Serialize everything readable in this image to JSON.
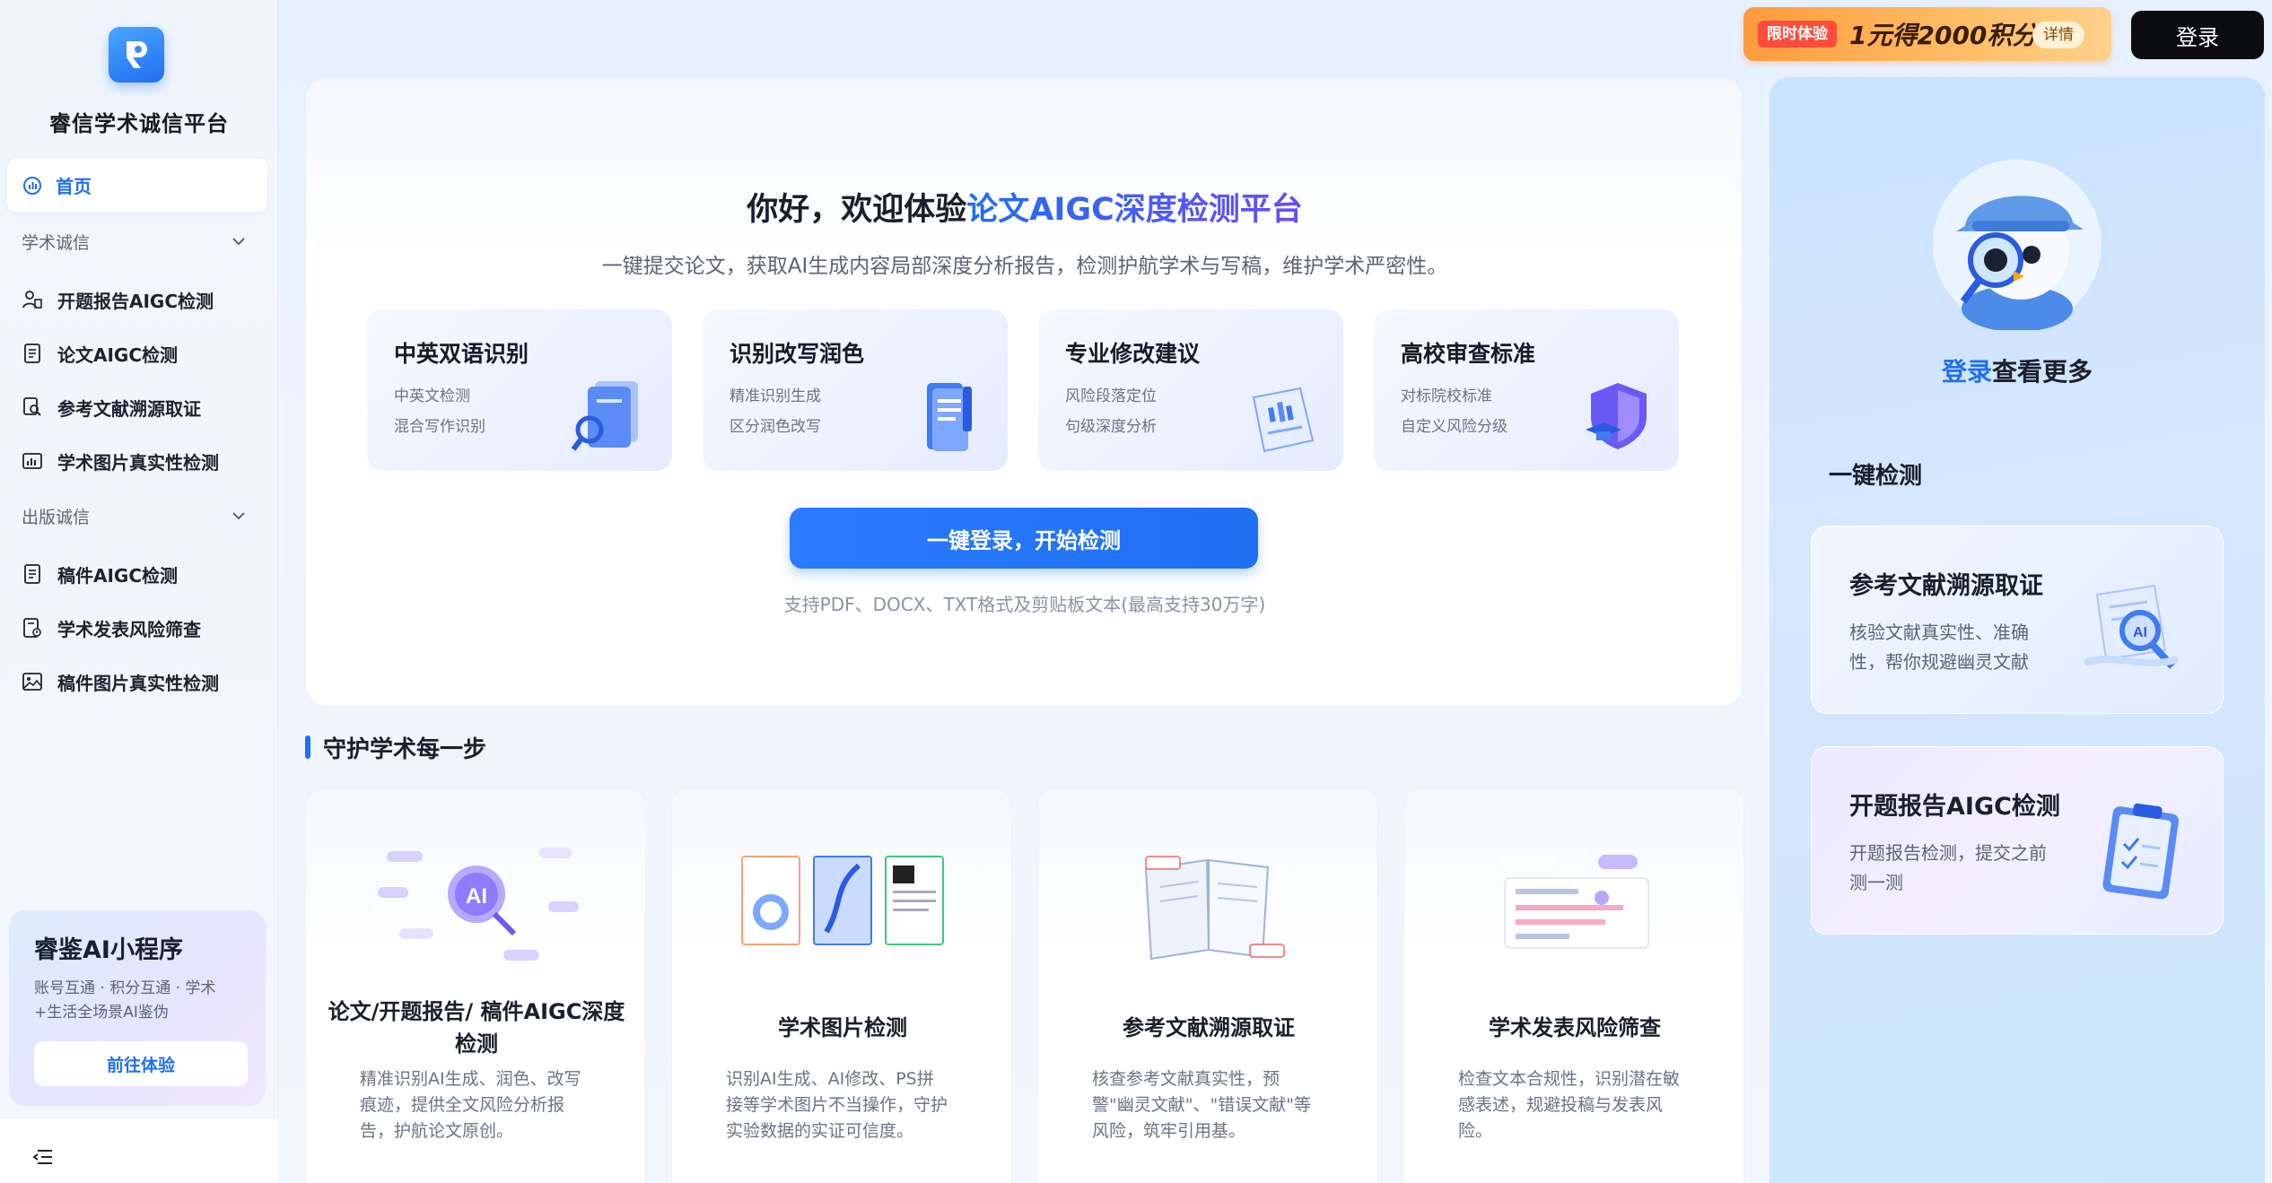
{
  "sidebar": {
    "brand": "睿信学术诚信平台",
    "home_label": "首页",
    "groups": [
      {
        "label": "学术诚信",
        "items": [
          {
            "label": "开题报告AIGC检测",
            "icon": "person-doc-icon"
          },
          {
            "label": "论文AIGC检测",
            "icon": "document-icon"
          },
          {
            "label": "参考文献溯源取证",
            "icon": "trace-icon"
          },
          {
            "label": "学术图片真实性检测",
            "icon": "image-chart-icon"
          }
        ]
      },
      {
        "label": "出版诚信",
        "items": [
          {
            "label": "稿件AIGC检测",
            "icon": "document-icon"
          },
          {
            "label": "学术发表风险筛查",
            "icon": "risk-doc-icon"
          },
          {
            "label": "稿件图片真实性检测",
            "icon": "picture-icon"
          }
        ]
      }
    ],
    "mini_program": {
      "title": "睿鉴AI小程序",
      "desc": "账号互通 · 积分互通 · 学术+生活全场景AI鉴伪",
      "button": "前往体验"
    }
  },
  "topbar": {
    "promo_tag": "限时体验",
    "promo_text": "1元得2000积分",
    "promo_more": "详情",
    "login": "登录"
  },
  "hero": {
    "title_prefix": "你好，欢迎体验",
    "title_highlight": "论文AIGC深度检测平台",
    "subtitle": "一键提交论文，获取AI生成内容局部深度分析报告，检测护航学术与写稿，维护学术严密性。",
    "features": [
      {
        "title": "中英双语识别",
        "line1": "中英文检测",
        "line2": "混合写作识别"
      },
      {
        "title": "识别改写润色",
        "line1": "精准识别生成",
        "line2": "区分润色改写"
      },
      {
        "title": "专业修改建议",
        "line1": "风险段落定位",
        "line2": "句级深度分析"
      },
      {
        "title": "高校审查标准",
        "line1": "对标院校标准",
        "line2": "自定义风险分级"
      }
    ],
    "cta": "一键登录，开始检测",
    "hint": "支持PDF、DOCX、TXT格式及剪贴板文本(最高支持30万字)"
  },
  "section": {
    "title": "守护学术每一步",
    "cards": [
      {
        "title": "论文/开题报告/ 稿件AIGC深度检测",
        "desc": "精准识别AI生成、润色、改写痕迹，提供全文风险分析报告，护航论文原创。"
      },
      {
        "title": "学术图片检测",
        "desc": "识别AI生成、AI修改、PS拼接等学术图片不当操作，守护实验数据的实证可信度。"
      },
      {
        "title": "参考文献溯源取证",
        "desc": "核查参考文献真实性，预警\"幽灵文献\"、\"错误文献\"等风险，筑牢引用基。"
      },
      {
        "title": "学术发表风险筛查",
        "desc": "检查文本合规性，识别潜在敏感表述，规避投稿与发表风险。"
      }
    ]
  },
  "right_panel": {
    "login_link": "登录",
    "login_suffix": "查看更多",
    "section_title": "一键检测",
    "cards": [
      {
        "title": "参考文献溯源取证",
        "desc": "核验文献真实性、准确性，帮你规避幽灵文献"
      },
      {
        "title": "开题报告AIGC检测",
        "desc": "开题报告检测，提交之前测一测"
      }
    ]
  },
  "colors": {
    "accent": "#1f6ff2",
    "accent_purple": "#6b4cf6",
    "promo_orange": "#ffb05a",
    "login_black": "#0b0c10"
  }
}
